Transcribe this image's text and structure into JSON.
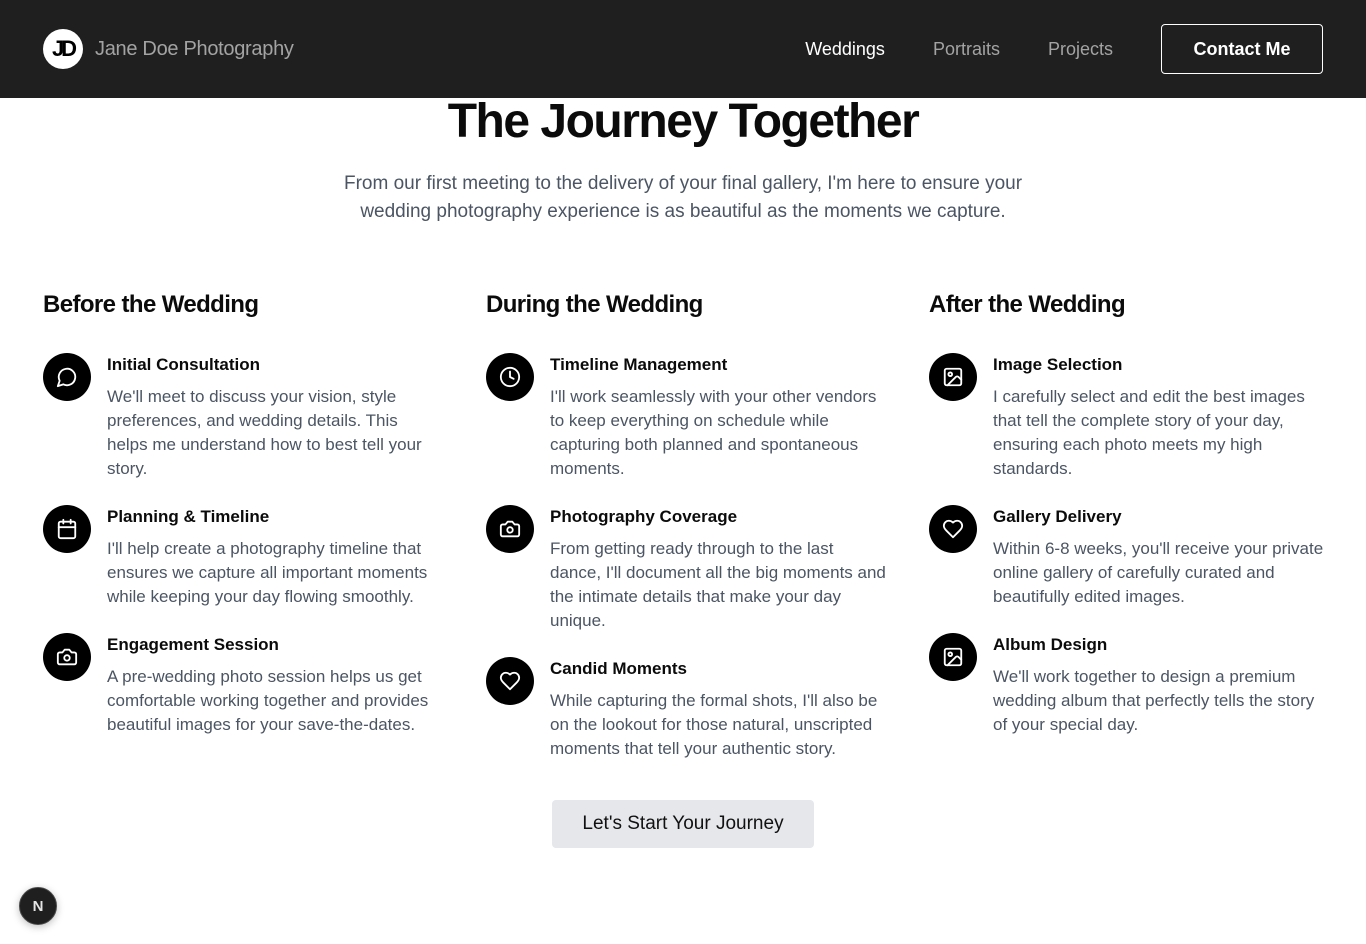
{
  "header": {
    "logo_text": "JD",
    "brand_name": "Jane Doe Photography",
    "nav": [
      {
        "label": "Weddings",
        "active": true
      },
      {
        "label": "Portraits",
        "active": false
      },
      {
        "label": "Projects",
        "active": false
      }
    ],
    "contact_label": "Contact Me"
  },
  "hero": {
    "title": "The Journey Together",
    "subtitle": "From our first meeting to the delivery of your final gallery, I'm here to ensure your wedding photography experience is as beautiful as the moments we capture."
  },
  "columns": [
    {
      "title": "Before the Wedding",
      "steps": [
        {
          "icon": "message-circle-icon",
          "title": "Initial Consultation",
          "desc": "We'll meet to discuss your vision, style preferences, and wedding details. This helps me understand how to best tell your story."
        },
        {
          "icon": "calendar-icon",
          "title": "Planning & Timeline",
          "desc": "I'll help create a photography timeline that ensures we capture all important moments while keeping your day flowing smoothly."
        },
        {
          "icon": "camera-icon",
          "title": "Engagement Session",
          "desc": "A pre-wedding photo session helps us get comfortable working together and provides beautiful images for your save-the-dates."
        }
      ]
    },
    {
      "title": "During the Wedding",
      "steps": [
        {
          "icon": "clock-icon",
          "title": "Timeline Management",
          "desc": "I'll work seamlessly with your other vendors to keep everything on schedule while capturing both planned and spontaneous moments."
        },
        {
          "icon": "camera-icon",
          "title": "Photography Coverage",
          "desc": "From getting ready through to the last dance, I'll document all the big moments and the intimate details that make your day unique."
        },
        {
          "icon": "heart-icon",
          "title": "Candid Moments",
          "desc": "While capturing the formal shots, I'll also be on the lookout for those natural, unscripted moments that tell your authentic story."
        }
      ]
    },
    {
      "title": "After the Wedding",
      "steps": [
        {
          "icon": "image-icon",
          "title": "Image Selection",
          "desc": "I carefully select and edit the best images that tell the complete story of your day, ensuring each photo meets my high standards."
        },
        {
          "icon": "heart-icon",
          "title": "Gallery Delivery",
          "desc": "Within 6-8 weeks, you'll receive your private online gallery of carefully curated and beautifully edited images."
        },
        {
          "icon": "image-icon",
          "title": "Album Design",
          "desc": "We'll work together to design a premium wedding album that perfectly tells the story of your special day."
        }
      ]
    }
  ],
  "cta_label": "Let's Start Your Journey",
  "dev_badge": "N",
  "colors": {
    "nav_bg": "#1f1f1f",
    "nav_inactive": "#a3a3a3",
    "icon_bg": "#000000",
    "body_text": "#4b5563",
    "cta_bg": "#e5e7eb"
  }
}
